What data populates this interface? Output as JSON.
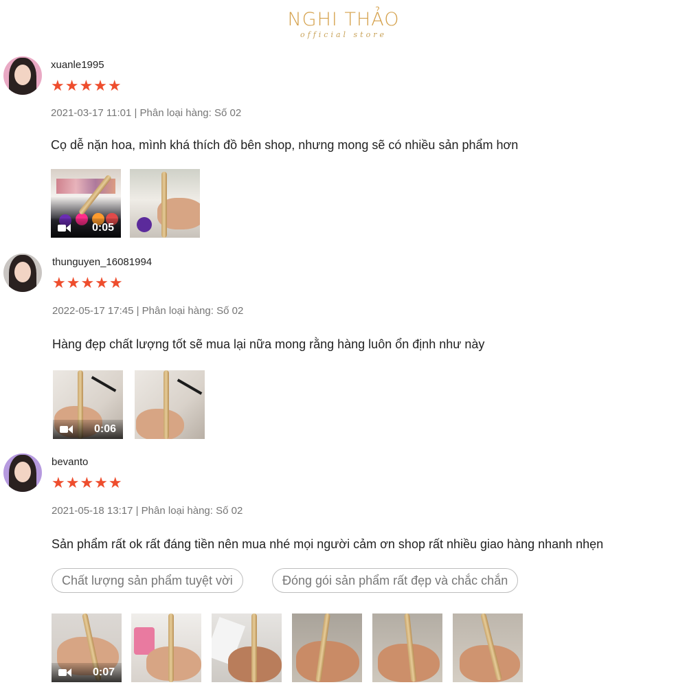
{
  "brand": {
    "name": "NGHI THẢO",
    "tagline": "official store"
  },
  "reviews": [
    {
      "username": "xuanle1995",
      "stars": "★★★★★",
      "rating": 5,
      "meta": "2021-03-17 11:01 | Phân loại hàng: Số 02",
      "comment": "Cọ dễ nặn hoa, mình khá thích đồ bên shop, nhưng mong sẽ có nhiều sản phẩm hơn",
      "video_duration": "0:05"
    },
    {
      "username": "thunguyen_16081994",
      "stars": "★★★★★",
      "rating": 5,
      "meta": "2022-05-17 17:45 | Phân loại hàng: Số 02",
      "comment": "Hàng đẹp chất lượng tốt sẽ mua lại nữa mong rằng hàng luôn ổn định như này",
      "video_duration": "0:06"
    },
    {
      "username": "bevanto",
      "stars": "★★★★★",
      "rating": 5,
      "meta": "2021-05-18 13:17 | Phân loại hàng: Số 02",
      "comment": "Sản phẩm rất ok rất đáng tiền nên mua nhé mọi người cảm ơn shop rất nhiều giao hàng nhanh nhẹn",
      "tags": [
        "Chất lượng sản phẩm tuyệt vời",
        "Đóng gói sản phẩm rất đẹp và chắc chắn"
      ],
      "video_duration": "0:07"
    }
  ],
  "icons": {
    "video": "video-camera-icon",
    "star": "star-icon"
  },
  "colors": {
    "star": "#ee4d2d",
    "brand": "#d4a04a",
    "meta": "#757575"
  }
}
